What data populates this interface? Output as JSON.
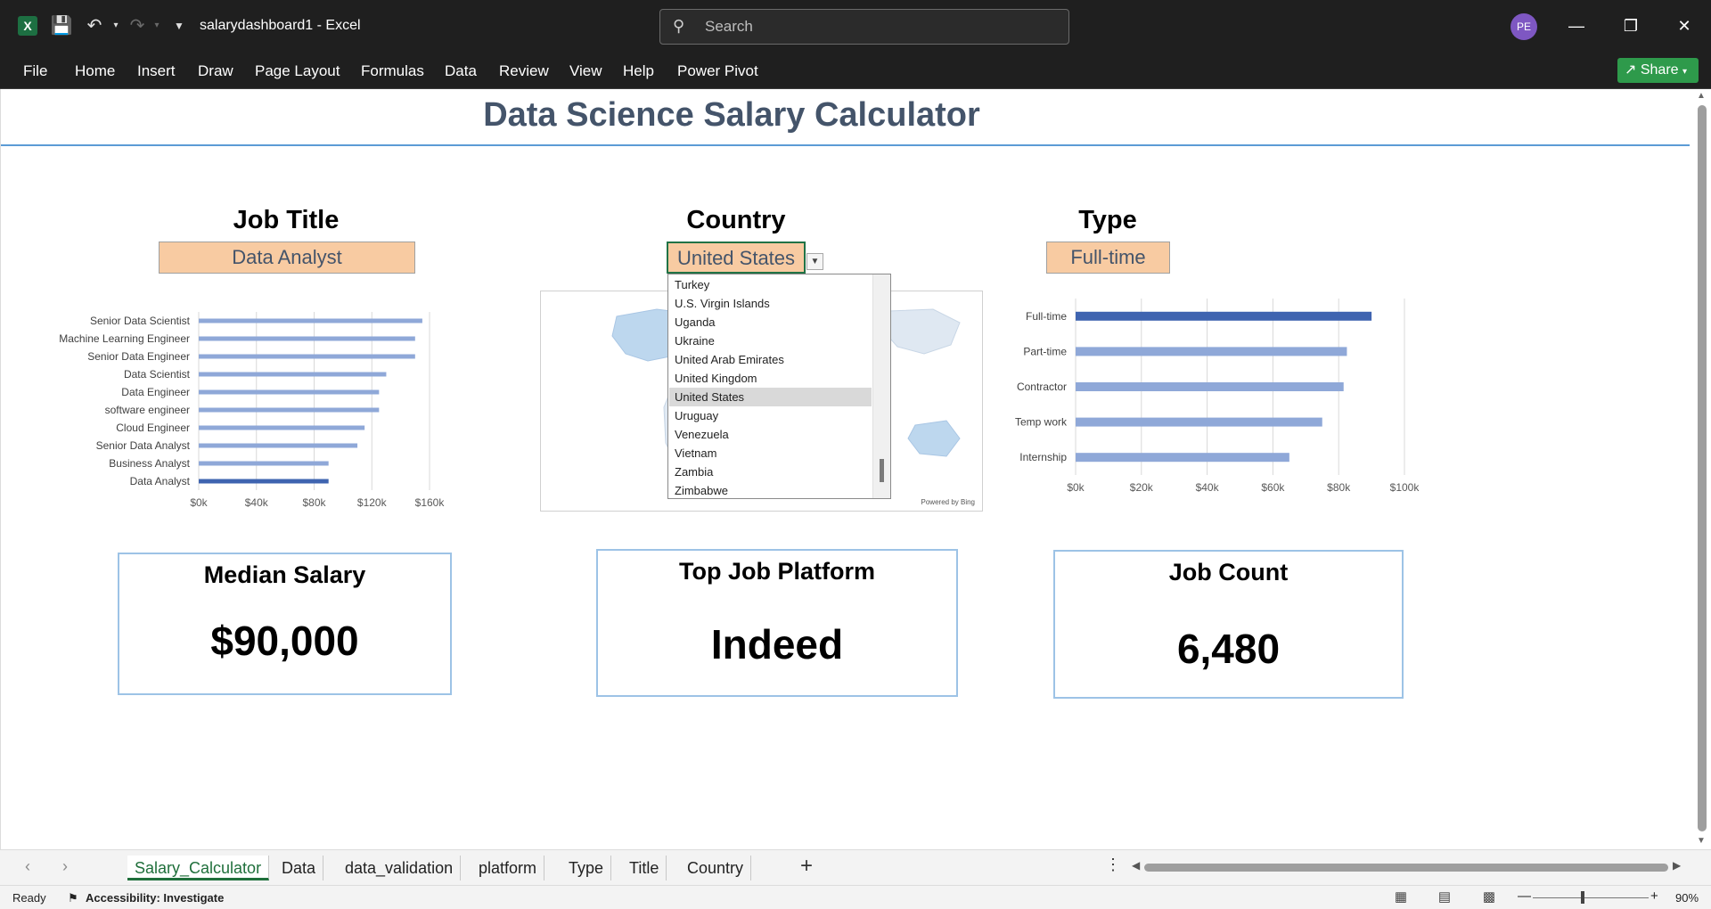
{
  "window": {
    "doc_title": "salarydashboard1  -  Excel",
    "search_placeholder": "Search",
    "avatar_initials": "PE"
  },
  "menu": {
    "items": [
      "File",
      "Home",
      "Insert",
      "Draw",
      "Page Layout",
      "Formulas",
      "Data",
      "Review",
      "View",
      "Help",
      "Power Pivot"
    ],
    "share_label": "Share"
  },
  "dashboard": {
    "title": "Data Science Salary Calculator",
    "job_title": {
      "label": "Job Title",
      "value": "Data Analyst"
    },
    "country": {
      "label": "Country",
      "value": "United States"
    },
    "type": {
      "label": "Type",
      "value": "Full-time"
    },
    "country_options": [
      "Turkey",
      "U.S. Virgin Islands",
      "Uganda",
      "Ukraine",
      "United Arab Emirates",
      "United Kingdom",
      "United States",
      "Uruguay",
      "Venezuela",
      "Vietnam",
      "Zambia",
      "Zimbabwe"
    ],
    "country_selected": "United States",
    "map_credit": "Powered by Bing",
    "kpis": {
      "median_salary": {
        "label": "Median Salary",
        "value": "$90,000"
      },
      "top_platform": {
        "label": "Top Job Platform",
        "value": "Indeed"
      },
      "job_count": {
        "label": "Job Count",
        "value": "6,480"
      }
    }
  },
  "chart_data": [
    {
      "type": "bar",
      "orientation": "horizontal",
      "categories": [
        "Senior Data Scientist",
        "Machine Learning Engineer",
        "Senior Data Engineer",
        "Data Scientist",
        "Data Engineer",
        "software engineer",
        "Cloud Engineer",
        "Senior Data Analyst",
        "Business Analyst",
        "Data Analyst"
      ],
      "values": [
        155000,
        150000,
        150000,
        130000,
        125000,
        125000,
        115000,
        110000,
        90000,
        90000
      ],
      "highlight": "Data Analyst",
      "xlim": [
        0,
        160000
      ],
      "xticks": [
        "$0k",
        "$40k",
        "$80k",
        "$120k",
        "$160k"
      ],
      "grid": true,
      "colors": {
        "bar": "#8fa8d8",
        "highlight": "#3f64b0"
      }
    },
    {
      "type": "bar",
      "orientation": "horizontal",
      "categories": [
        "Full-time",
        "Part-time",
        "Contractor",
        "Temp work",
        "Internship"
      ],
      "values": [
        90000,
        82500,
        81500,
        75000,
        65000
      ],
      "highlight": "Full-time",
      "xlim": [
        0,
        100000
      ],
      "xticks": [
        "$0k",
        "$20k",
        "$40k",
        "$60k",
        "$80k",
        "$100k"
      ],
      "grid": true,
      "colors": {
        "bar": "#8fa8d8",
        "highlight": "#3f64b0"
      }
    }
  ],
  "sheet_tabs": [
    "Salary_Calculator",
    "Data",
    "data_validation",
    "platform",
    "Type",
    "Title",
    "Country"
  ],
  "active_tab": "Salary_Calculator",
  "status": {
    "ready": "Ready",
    "accessibility": "Accessibility: Investigate",
    "zoom": "90%"
  }
}
